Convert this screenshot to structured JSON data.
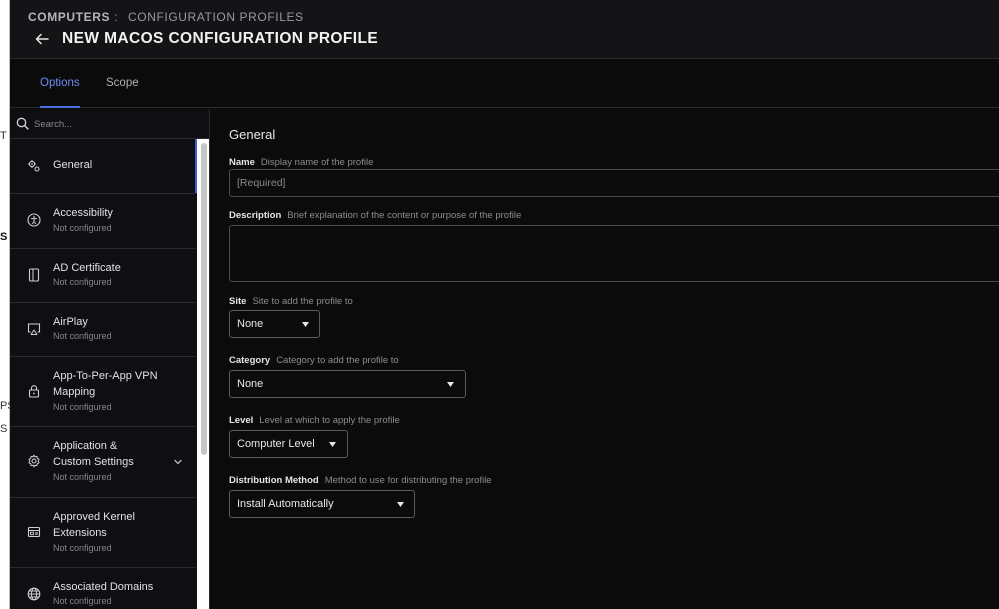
{
  "background_edge": {
    "letters": [
      "T",
      "S",
      "PS",
      "S"
    ]
  },
  "header": {
    "breadcrumb_root": "COMPUTERS",
    "breadcrumb_sep": ":",
    "breadcrumb_current": "CONFIGURATION PROFILES",
    "title": "NEW MACOS CONFIGURATION PROFILE"
  },
  "tabs": [
    {
      "label": "Options",
      "active": true
    },
    {
      "label": "Scope",
      "active": false
    }
  ],
  "sidebar": {
    "search_placeholder": "Search...",
    "items": [
      {
        "label": "General",
        "status": "",
        "icon": "gear-cluster-icon",
        "active": true
      },
      {
        "label": "Accessibility",
        "status": "Not configured",
        "icon": "accessibility-icon"
      },
      {
        "label": "AD Certificate",
        "status": "Not configured",
        "icon": "certificate-icon"
      },
      {
        "label": "AirPlay",
        "status": "Not configured",
        "icon": "airplay-icon"
      },
      {
        "label_line1": "App-To-Per-App VPN",
        "label_line2": "Mapping",
        "status": "Not configured",
        "icon": "lock-icon"
      },
      {
        "label_line1": "Application &",
        "label_line2": "Custom Settings",
        "status": "Not configured",
        "icon": "gear-icon",
        "expandable": true
      },
      {
        "label_line1": "Approved Kernel",
        "label_line2": "Extensions",
        "status": "Not configured",
        "icon": "kernel-extension-icon"
      },
      {
        "label": "Associated Domains",
        "status": "Not configured",
        "icon": "globe-icon"
      }
    ]
  },
  "general": {
    "section_title": "General",
    "name": {
      "label": "Name",
      "help": "Display name of the profile",
      "placeholder": "[Required]"
    },
    "description": {
      "label": "Description",
      "help": "Brief explanation of the content or purpose of the profile"
    },
    "site": {
      "label": "Site",
      "help": "Site to add the profile to",
      "value": "None"
    },
    "category": {
      "label": "Category",
      "help": "Category to add the profile to",
      "value": "None"
    },
    "level": {
      "label": "Level",
      "help": "Level at which to apply the profile",
      "value": "Computer Level"
    },
    "distribution": {
      "label": "Distribution Method",
      "help": "Method to use for distributing the profile",
      "value": "Install Automatically"
    }
  },
  "colors": {
    "accent": "#6c8ef2",
    "background": "#0b0b0c",
    "header": "#141416",
    "border": "#2a2a2d"
  }
}
